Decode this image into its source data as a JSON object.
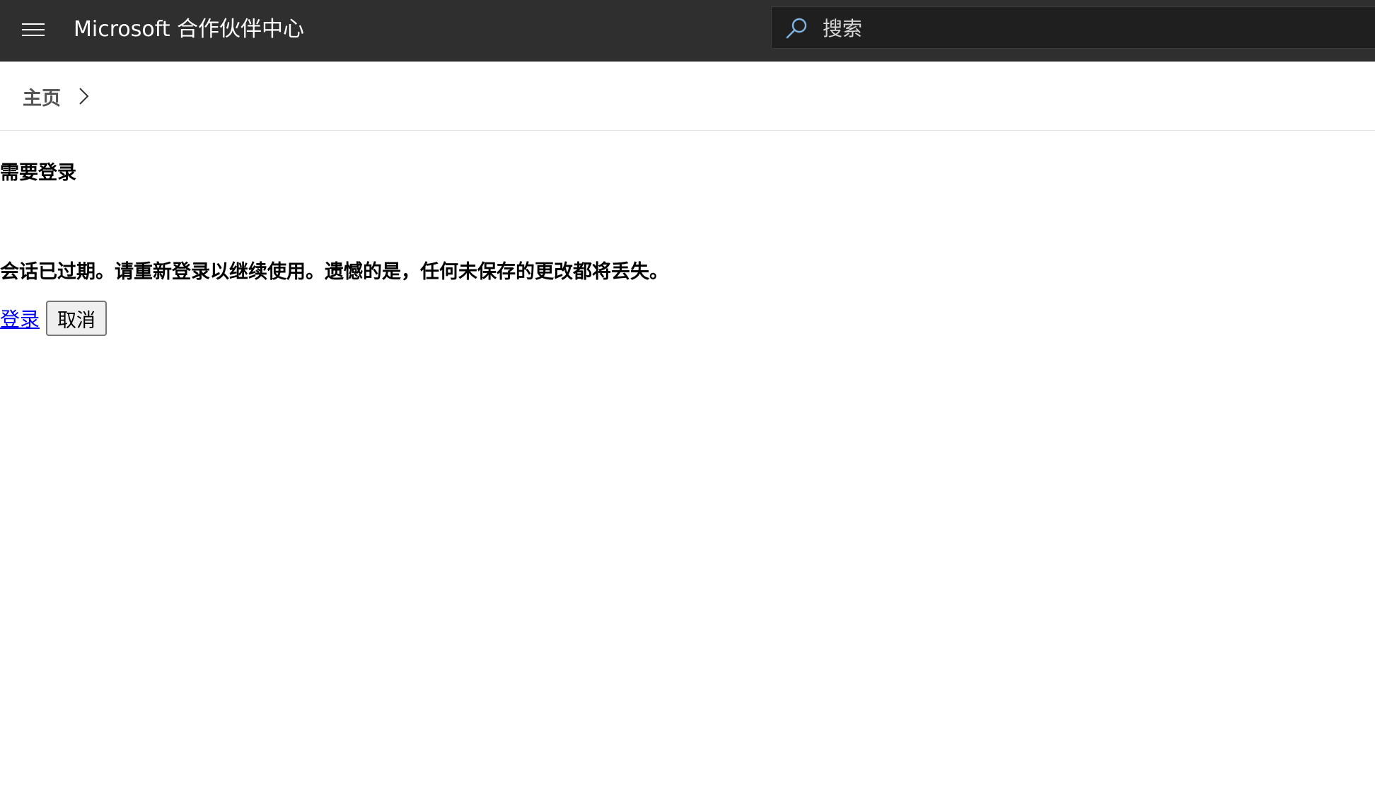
{
  "header": {
    "brand": "Microsoft 合作伙伴中心",
    "menu_icon": "hamburger-menu-icon",
    "search": {
      "placeholder": "搜索",
      "icon": "search-icon"
    }
  },
  "breadcrumb": {
    "home": "主页",
    "separator_icon": "chevron-right-icon"
  },
  "dialog": {
    "title": "需要登录",
    "message": "会话已过期。请重新登录以继续使用。遗憾的是，任何未保存的更改都将丢失。",
    "signin_label": "登录",
    "cancel_label": "取消"
  },
  "colors": {
    "header_bg": "#2f2f2f",
    "search_bg": "#1f1f1f",
    "search_icon": "#7fb3e0",
    "link": "#0000ee"
  }
}
